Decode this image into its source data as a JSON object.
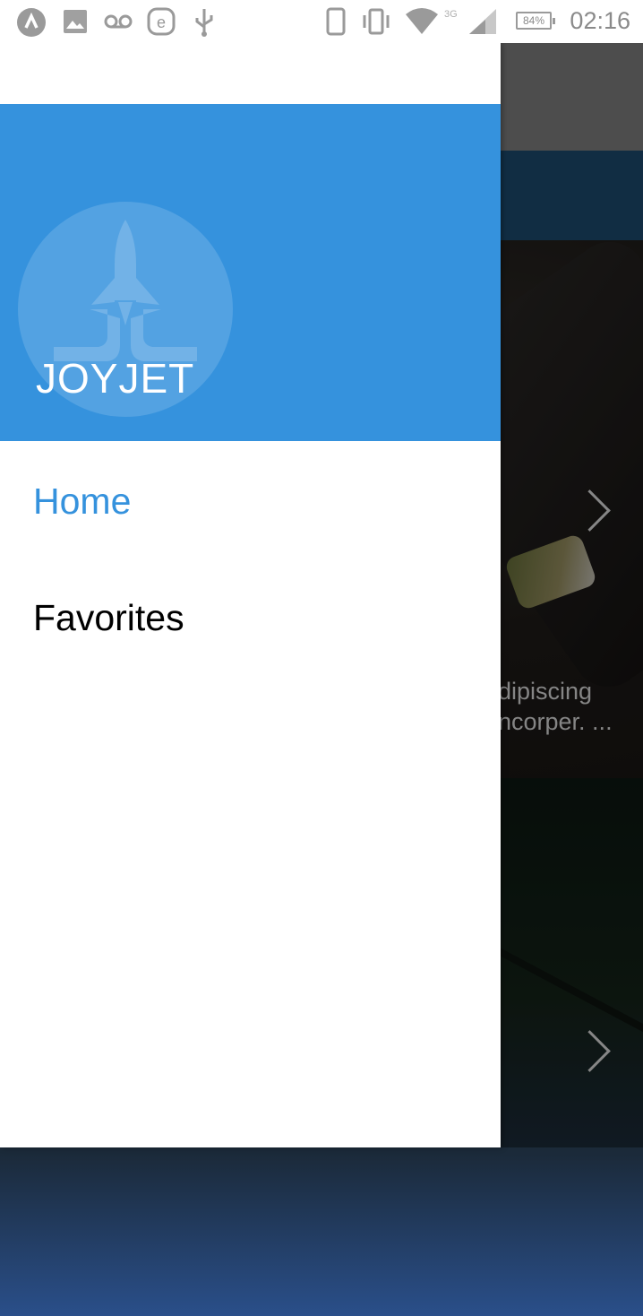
{
  "status_bar": {
    "time": "02:16",
    "battery": "84%",
    "network": "3G",
    "icons": [
      "notification-app-icon",
      "image-icon",
      "voicemail-icon",
      "e-app-icon",
      "usb-icon",
      "phone-icon",
      "vibrate-icon",
      "wifi-icon",
      "signal-icon",
      "battery-icon"
    ]
  },
  "drawer": {
    "title": "JOYJET",
    "logo_icon": "rocket-icon",
    "items": [
      {
        "label": "Home",
        "active": true
      },
      {
        "label": "Favorites",
        "active": false
      }
    ],
    "header_color": "#3592dd",
    "active_color": "#3592dd"
  },
  "background": {
    "card1_text_line1": "dipiscing",
    "card1_text_line2": "ncorper. ...",
    "chevron_icon": "chevron-right-icon"
  }
}
